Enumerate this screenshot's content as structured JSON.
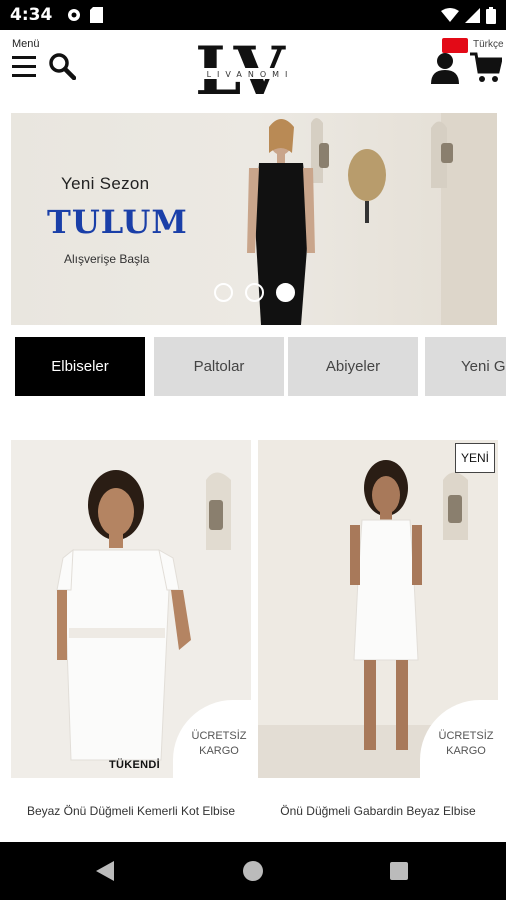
{
  "status_bar": {
    "time": "4:34"
  },
  "header": {
    "menu_label": "Menü",
    "logo_text": "LV",
    "logo_subtext": "LIVANOMI",
    "language": "Türkçe"
  },
  "banner": {
    "subtitle": "Yeni Sezon",
    "title": "TULUM",
    "cta": "Alışverişe Başla",
    "slides": 3,
    "active_slide": 3
  },
  "categories": [
    {
      "label": "Elbiseler",
      "active": true
    },
    {
      "label": "Paltolar",
      "active": false
    },
    {
      "label": "Abiyeler",
      "active": false
    },
    {
      "label": "Yeni Gelenler",
      "active": false
    }
  ],
  "products": [
    {
      "name": "Beyaz Önü Düğmeli Kemerli Kot Elbise",
      "badge_kargo_1": "ÜCRETSİZ",
      "badge_kargo_2": "KARGO",
      "badge_status": "TÜKENDİ"
    },
    {
      "name": "Önü Düğmeli Gabardin Beyaz Elbise",
      "badge_kargo_1": "ÜCRETSİZ",
      "badge_kargo_2": "KARGO",
      "badge_new": "YENİ"
    }
  ],
  "colors": {
    "accent": "#1a3fa8",
    "active_tab": "#000000",
    "inactive_tab": "#dcdcdc"
  }
}
